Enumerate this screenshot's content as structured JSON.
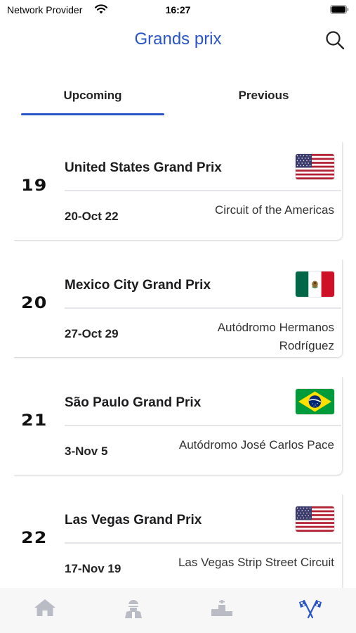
{
  "status_bar": {
    "carrier": "Network Provider",
    "time": "16:27"
  },
  "header": {
    "title": "Grands prix",
    "search_icon": "search-icon"
  },
  "tabs": [
    {
      "label": "Upcoming",
      "selected": true
    },
    {
      "label": "Previous",
      "selected": false
    }
  ],
  "races": [
    {
      "round": "19",
      "name": "United States Grand Prix",
      "dates": "20-Oct 22",
      "circuit": "Circuit of the Americas",
      "flag": "usa-flag-icon"
    },
    {
      "round": "20",
      "name": "Mexico City Grand Prix",
      "dates": "27-Oct 29",
      "circuit": "Autódromo Hermanos Rodríguez",
      "flag": "mexico-flag-icon"
    },
    {
      "round": "21",
      "name": "São Paulo Grand Prix",
      "dates": "3-Nov 5",
      "circuit": "Autódromo José Carlos Pace",
      "flag": "brazil-flag-icon"
    },
    {
      "round": "22",
      "name": "Las Vegas Grand Prix",
      "dates": "17-Nov 19",
      "circuit": "Las Vegas Strip Street Circuit",
      "flag": "usa-flag-icon"
    }
  ],
  "bottom_tabs": [
    {
      "icon": "home-icon",
      "selected": false
    },
    {
      "icon": "driver-icon",
      "selected": false
    },
    {
      "icon": "podium-icon",
      "selected": false
    },
    {
      "icon": "checkered-flags-icon",
      "selected": true
    }
  ],
  "colors": {
    "accent": "#2a55c7",
    "inactive_icon": "#b9bcc4",
    "divider": "#e6e6ea"
  }
}
